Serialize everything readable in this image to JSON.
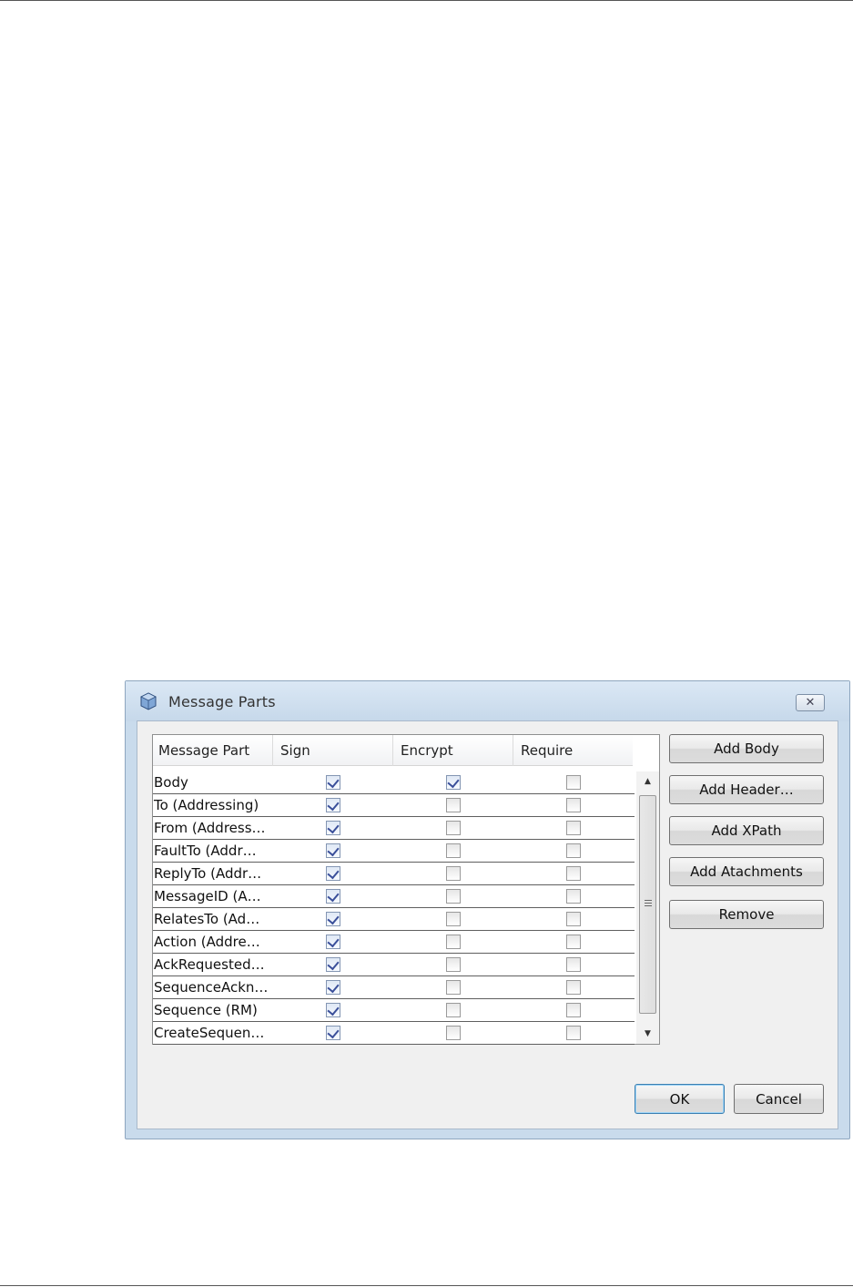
{
  "dialog": {
    "title": "Message Parts",
    "close_label": "✕"
  },
  "table": {
    "columns": [
      "Message Part",
      "Sign",
      "Encrypt",
      "Require"
    ],
    "rows": [
      {
        "name": "Body",
        "sign": true,
        "encrypt": true,
        "require": false
      },
      {
        "name": "To (Addressing)",
        "sign": true,
        "encrypt": false,
        "require": false
      },
      {
        "name": "From (Address…",
        "sign": true,
        "encrypt": false,
        "require": false
      },
      {
        "name": "FaultTo (Addr…",
        "sign": true,
        "encrypt": false,
        "require": false
      },
      {
        "name": "ReplyTo (Addr…",
        "sign": true,
        "encrypt": false,
        "require": false
      },
      {
        "name": "MessageID (A…",
        "sign": true,
        "encrypt": false,
        "require": false
      },
      {
        "name": "RelatesTo (Ad…",
        "sign": true,
        "encrypt": false,
        "require": false
      },
      {
        "name": "Action (Addre…",
        "sign": true,
        "encrypt": false,
        "require": false
      },
      {
        "name": "AckRequested…",
        "sign": true,
        "encrypt": false,
        "require": false
      },
      {
        "name": "SequenceAckn…",
        "sign": true,
        "encrypt": false,
        "require": false
      },
      {
        "name": "Sequence (RM)",
        "sign": true,
        "encrypt": false,
        "require": false
      },
      {
        "name": "CreateSequen…",
        "sign": true,
        "encrypt": false,
        "require": false
      }
    ]
  },
  "buttons": {
    "add_body": "Add Body",
    "add_header": "Add Header…",
    "add_xpath": "Add XPath",
    "add_attachments": "Add Atachments",
    "remove": "Remove",
    "ok": "OK",
    "cancel": "Cancel"
  },
  "icons": {
    "title": "cube-icon",
    "scroll_up": "arrow-up-icon",
    "scroll_down": "arrow-down-icon"
  },
  "colors": {
    "dialog_frame": "#c9dbec",
    "client_bg": "#f0f0f0",
    "check_mark": "#3a4f9a",
    "default_button_border": "#3c7fb1"
  }
}
